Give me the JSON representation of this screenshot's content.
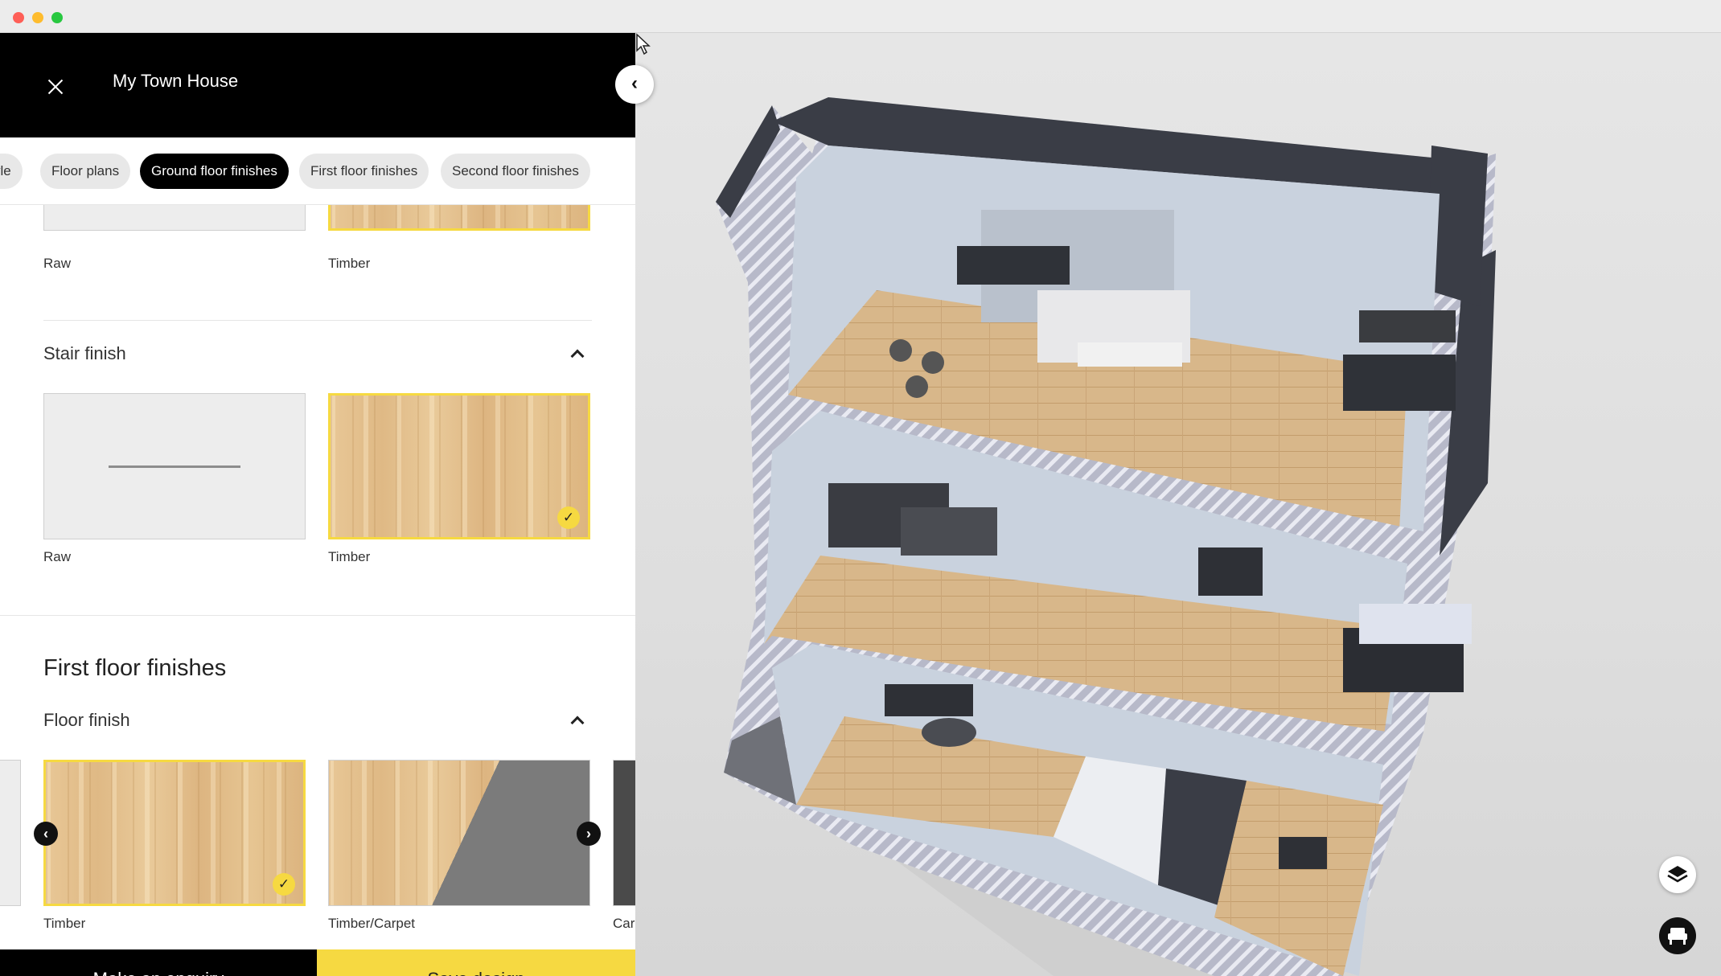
{
  "window": {
    "controls": [
      "close",
      "minimize",
      "maximize"
    ]
  },
  "panel": {
    "title": "My Town House",
    "close_icon": "close-icon",
    "collapse_icon": "chevron-left-icon"
  },
  "tabs": [
    {
      "label": "yle"
    },
    {
      "label": "Floor plans"
    },
    {
      "label": "Ground floor finishes",
      "active": true
    },
    {
      "label": "First floor finishes"
    },
    {
      "label": "Second floor finishes"
    }
  ],
  "ground_floor": {
    "prev_options": [
      {
        "label": "Raw"
      },
      {
        "label": "Timber"
      }
    ],
    "stair_finish": {
      "title": "Stair finish",
      "options": [
        {
          "label": "Raw",
          "selected": false
        },
        {
          "label": "Timber",
          "selected": true
        }
      ]
    }
  },
  "first_floor": {
    "title": "First floor finishes",
    "floor_finish": {
      "title": "Floor finish",
      "options": [
        {
          "label": "Timber",
          "selected": true
        },
        {
          "label": "Timber/Carpet",
          "selected": false
        },
        {
          "label": "Carp",
          "selected": false
        }
      ]
    }
  },
  "icons": {
    "check": "✓",
    "prev": "‹",
    "next": "›",
    "collapse": "‹"
  },
  "footer": {
    "enquiry_label": "Make an enquiry",
    "save_label": "Save design"
  },
  "viewport": {
    "layers_icon": "layers-icon",
    "furniture_icon": "armchair-icon"
  },
  "colors": {
    "accent": "#f6d941",
    "header": "#000000",
    "chip": "#e8e8e8"
  }
}
